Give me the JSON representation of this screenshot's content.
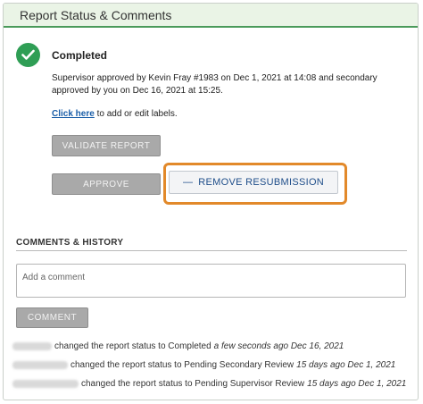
{
  "header": {
    "title": "Report Status & Comments"
  },
  "status": {
    "title": "Completed",
    "description": "Supervisor approved by Kevin Fray #1983 on Dec 1, 2021 at 14:08 and secondary approved by you on Dec 16, 2021 at 15:25.",
    "check_icon_color": "#2f9e55"
  },
  "labels": {
    "link_text": "Click here",
    "rest_text": " to add or edit labels."
  },
  "buttons": {
    "validate": "VALIDATE REPORT",
    "approve": "APPROVE",
    "remove_resubmission": "REMOVE RESUBMISSION",
    "remove_icon": "minus-icon",
    "comment": "COMMENT"
  },
  "highlight_color": "#e2892a",
  "comments": {
    "section_title": "COMMENTS & HISTORY",
    "placeholder": "Add a comment"
  },
  "history": [
    {
      "text": "changed the report status to Completed",
      "time": "a few seconds ago Dec 16, 2021"
    },
    {
      "text": "changed the report status to Pending Secondary Review",
      "time": "15 days ago Dec 1, 2021"
    },
    {
      "text": "changed the report status to Pending Supervisor Review",
      "time": "15 days ago Dec 1, 2021"
    }
  ]
}
